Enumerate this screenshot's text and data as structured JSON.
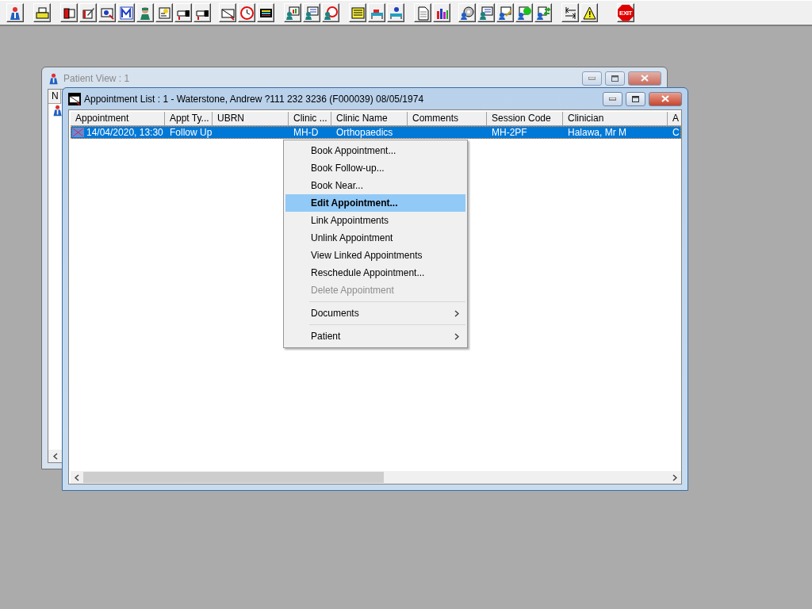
{
  "toolbar": {
    "exit_label": "EXIT"
  },
  "patient_view": {
    "title": "Patient View : 1",
    "active": false,
    "column_1": "N"
  },
  "appointment_list": {
    "title": "Appointment List : 1 - Waterstone, Andrew ?111 232 3236 (F000039) 08/05/1974",
    "active": true,
    "columns": [
      "Appointment",
      "Appt Ty...",
      "UBRN",
      "Clinic ...",
      "Clinic Name",
      "Comments",
      "Session Code",
      "Clinician",
      "A"
    ],
    "rows": [
      {
        "selected": true,
        "cells": [
          "14/04/2020, 13:30",
          "Follow Up",
          "",
          "MH-D",
          "Orthopaedics",
          "",
          "MH-2PF",
          "Halawa, Mr M",
          "C"
        ]
      }
    ]
  },
  "context_menu": {
    "items": [
      {
        "kind": "item",
        "label": "Book Appointment...",
        "selected": false,
        "disabled": false,
        "submenu": false
      },
      {
        "kind": "item",
        "label": "Book Follow-up...",
        "selected": false,
        "disabled": false,
        "submenu": false
      },
      {
        "kind": "item",
        "label": "Book Near...",
        "selected": false,
        "disabled": false,
        "submenu": false
      },
      {
        "kind": "item",
        "label": "Edit Appointment...",
        "selected": true,
        "disabled": false,
        "submenu": false
      },
      {
        "kind": "item",
        "label": "Link Appointments",
        "selected": false,
        "disabled": false,
        "submenu": false
      },
      {
        "kind": "item",
        "label": "Unlink Appointment",
        "selected": false,
        "disabled": false,
        "submenu": false
      },
      {
        "kind": "item",
        "label": "View Linked Appointments",
        "selected": false,
        "disabled": false,
        "submenu": false
      },
      {
        "kind": "item",
        "label": "Reschedule Appointment...",
        "selected": false,
        "disabled": false,
        "submenu": false
      },
      {
        "kind": "item",
        "label": "Delete Appointment",
        "selected": false,
        "disabled": true,
        "submenu": false
      },
      {
        "kind": "separator"
      },
      {
        "kind": "item",
        "label": "Documents",
        "selected": false,
        "disabled": false,
        "submenu": true
      },
      {
        "kind": "separator"
      },
      {
        "kind": "item",
        "label": "Patient",
        "selected": false,
        "disabled": false,
        "submenu": true
      }
    ]
  }
}
